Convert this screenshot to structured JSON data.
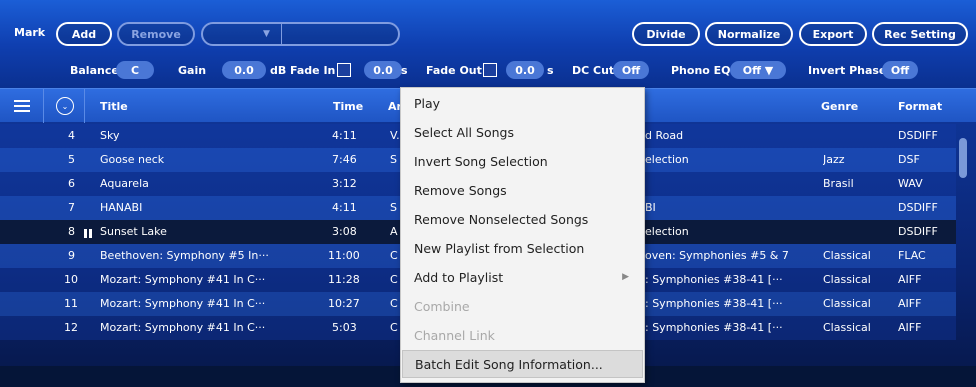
{
  "toolbar": {
    "mark": "Mark",
    "add": "Add",
    "remove": "Remove",
    "divide": "Divide",
    "normalize": "Normalize",
    "export": "Export",
    "rec_setting": "Rec Setting"
  },
  "controls": {
    "balance_label": "Balance",
    "balance_value": "C",
    "gain_label": "Gain",
    "gain_value": "0.0",
    "gain_unit": "dB",
    "fade_in_label": "Fade In",
    "fade_in_value": "0.0",
    "fade_in_unit": "s",
    "fade_out_label": "Fade Out",
    "fade_out_value": "0.0",
    "fade_out_unit": "s",
    "dc_cut_label": "DC Cut",
    "dc_cut_value": "Off",
    "phono_eq_label": "Phono EQ",
    "phono_eq_value": "Off ▼",
    "invert_phase_label": "Invert Phase",
    "invert_phase_value": "Off"
  },
  "columns": {
    "title": "Title",
    "time": "Time",
    "artist": "Ar",
    "genre": "Genre",
    "format": "Format"
  },
  "rows": [
    {
      "num": "4",
      "title": "Sky",
      "time": "4:11",
      "artist": "V.",
      "album": "d Road",
      "genre": "",
      "format": "DSDIFF"
    },
    {
      "num": "5",
      "title": "Goose neck",
      "time": "7:46",
      "artist": "S",
      "album": "election",
      "genre": "Jazz",
      "format": "DSF"
    },
    {
      "num": "6",
      "title": "Aquarela",
      "time": "3:12",
      "artist": "",
      "album": "",
      "genre": "Brasil",
      "format": "WAV"
    },
    {
      "num": "7",
      "title": "HANABI",
      "time": "4:11",
      "artist": "S",
      "album": "BI",
      "genre": "",
      "format": "DSDIFF"
    },
    {
      "num": "8",
      "title": "Sunset Lake",
      "time": "3:08",
      "artist": "A",
      "album": "election",
      "genre": "",
      "format": "DSDIFF"
    },
    {
      "num": "9",
      "title": "Beethoven: Symphony #5 In···",
      "time": "11:00",
      "artist": "C",
      "album": "oven: Symphonies #5 & 7",
      "genre": "Classical",
      "format": "FLAC"
    },
    {
      "num": "10",
      "title": "Mozart: Symphony #41 In C···",
      "time": "11:28",
      "artist": "C",
      "album": ": Symphonies #38-41 [···",
      "genre": "Classical",
      "format": "AIFF"
    },
    {
      "num": "11",
      "title": "Mozart: Symphony #41 In C···",
      "time": "10:27",
      "artist": "C",
      "album": ": Symphonies #38-41 [···",
      "genre": "Classical",
      "format": "AIFF"
    },
    {
      "num": "12",
      "title": "Mozart: Symphony #41 In C···",
      "time": "5:03",
      "artist": "C",
      "album": ": Symphonies #38-41 [···",
      "genre": "Classical",
      "format": "AIFF"
    }
  ],
  "menu": [
    "Play",
    "Select All Songs",
    "Invert Song Selection",
    "Remove Songs",
    "Remove Nonselected Songs",
    "New Playlist from Selection",
    "Add to Playlist",
    "Combine",
    "Channel Link",
    "Batch Edit Song Information..."
  ],
  "icons": {
    "menu": "hamburger-icon",
    "sort": "circle-chevron-icon",
    "playing": "pause-icon",
    "submenu": "triangle-right-icon",
    "dropdown": "triangle-down-icon"
  }
}
